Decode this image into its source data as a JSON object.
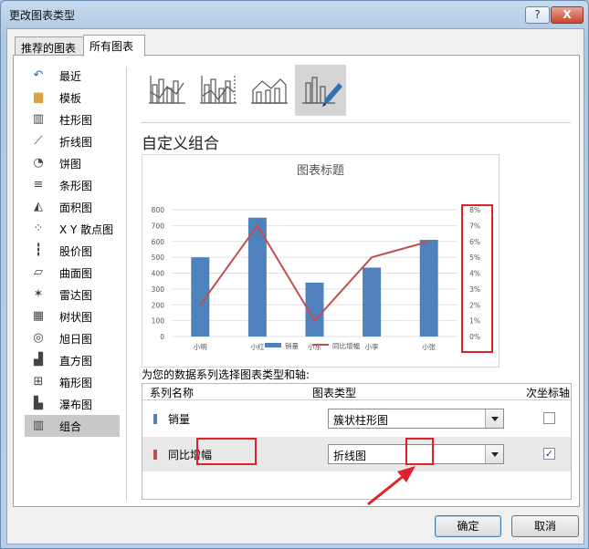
{
  "window": {
    "title": "更改图表类型",
    "help": "?",
    "close": "X"
  },
  "tabs": [
    {
      "label": "推荐的图表"
    },
    {
      "label": "所有图表"
    }
  ],
  "sidebar": {
    "items": [
      {
        "label": "最近",
        "icon": "recent-icon"
      },
      {
        "label": "模板",
        "icon": "folder-icon"
      },
      {
        "label": "柱形图",
        "icon": "column-chart-icon"
      },
      {
        "label": "折线图",
        "icon": "line-chart-icon"
      },
      {
        "label": "饼图",
        "icon": "pie-chart-icon"
      },
      {
        "label": "条形图",
        "icon": "bar-chart-icon"
      },
      {
        "label": "面积图",
        "icon": "area-chart-icon"
      },
      {
        "label": "X Y 散点图",
        "icon": "scatter-chart-icon"
      },
      {
        "label": "股价图",
        "icon": "stock-chart-icon"
      },
      {
        "label": "曲面图",
        "icon": "surface-chart-icon"
      },
      {
        "label": "雷达图",
        "icon": "radar-chart-icon"
      },
      {
        "label": "树状图",
        "icon": "treemap-chart-icon"
      },
      {
        "label": "旭日图",
        "icon": "sunburst-chart-icon"
      },
      {
        "label": "直方图",
        "icon": "histogram-chart-icon"
      },
      {
        "label": "箱形图",
        "icon": "box-chart-icon"
      },
      {
        "label": "瀑布图",
        "icon": "waterfall-chart-icon"
      },
      {
        "label": "组合",
        "icon": "combo-chart-icon"
      }
    ],
    "selected": "组合"
  },
  "combo_types": [
    "clustered-column-line-icon",
    "clustered-column-line-secondary-icon",
    "stacked-area-column-icon",
    "custom-combo-icon"
  ],
  "heading": "自定义组合",
  "chart_data": {
    "type": "bar",
    "title": "图表标题",
    "categories": [
      "小明",
      "小红",
      "小东",
      "小李",
      "小张"
    ],
    "series": [
      {
        "name": "销量",
        "type": "bar",
        "axis": "primary",
        "color": "#4f81bd",
        "values": [
          500,
          750,
          340,
          435,
          610
        ]
      },
      {
        "name": "同比增幅",
        "type": "line",
        "axis": "secondary",
        "color": "#c0504d",
        "values": [
          0.02,
          0.07,
          0.01,
          0.05,
          0.06
        ]
      }
    ],
    "ylim": [
      0,
      800
    ],
    "yticks": [
      "0",
      "100",
      "200",
      "300",
      "400",
      "500",
      "600",
      "700",
      "800"
    ],
    "y2lim": [
      0,
      0.08
    ],
    "y2ticks": [
      "0%",
      "1%",
      "2%",
      "3%",
      "4%",
      "5%",
      "6%",
      "7%",
      "8%"
    ],
    "legend": "bottom",
    "grid": true
  },
  "series_section": {
    "label": "为您的数据系列选择图表类型和轴:",
    "headers": {
      "name": "系列名称",
      "type": "图表类型",
      "secondary": "次坐标轴"
    },
    "rows": [
      {
        "name": "销量",
        "color": "#4f81bd",
        "chart_type": "簇状柱形图",
        "secondary": false
      },
      {
        "name": "同比增幅",
        "color": "#c0504d",
        "chart_type": "折线图",
        "secondary": true
      }
    ]
  },
  "buttons": {
    "ok": "确定",
    "cancel": "取消"
  }
}
